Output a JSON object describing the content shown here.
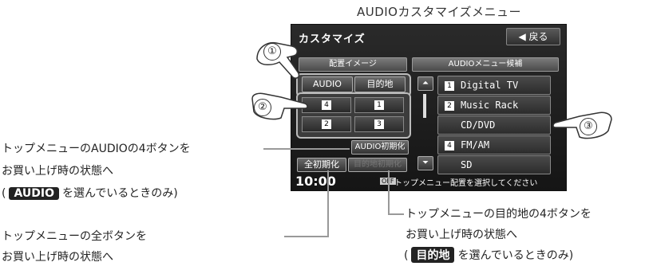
{
  "page_title": "AUDIOカスタマイズメニュー",
  "screen": {
    "title": "カスタマイズ",
    "back_button": "◀ 戻る",
    "layout_tab": "配置イメージ",
    "candidates_tab": "AUDIOメニュー候補",
    "select_audio": "AUDIO",
    "select_dest": "目的地",
    "grid_badges": [
      "4",
      "1",
      "2",
      "3"
    ],
    "audio_reset": "AUDIO初期化",
    "all_reset": "全初期化",
    "dest_reset": "目的地初期化",
    "clock": "10:00",
    "off_label": "OFF",
    "status_text": "トップメニュー配置を選択してください",
    "scroll_up": "⏶",
    "scroll_down": "⏷",
    "items": [
      {
        "badge": "1",
        "label": "Digital TV"
      },
      {
        "badge": "2",
        "label": "Music Rack"
      },
      {
        "badge": "",
        "label": "CD/DVD"
      },
      {
        "badge": "4",
        "label": "FM/AM"
      },
      {
        "badge": "",
        "label": "SD"
      }
    ]
  },
  "callouts": {
    "num1": "①",
    "num2": "②",
    "num3": "③"
  },
  "annotations": {
    "audio4_line1": "トップメニューのAUDIOの4ボタンを",
    "audio4_line2": "お買い上げ時の状態へ",
    "audio4_line3_prefix": "(",
    "audio4_chip": "AUDIO",
    "audio4_line3_suffix": "を選んでいるときのみ)",
    "all_line1": "トップメニューの全ボタンを",
    "all_line2": "お買い上げ時の状態へ",
    "dest_line1": "トップメニューの目的地の4ボタンを",
    "dest_line2": "お買い上げ時の状態へ",
    "dest_line3_prefix": "(",
    "dest_chip": "目的地",
    "dest_line3_suffix": "を選んでいるときのみ)"
  }
}
